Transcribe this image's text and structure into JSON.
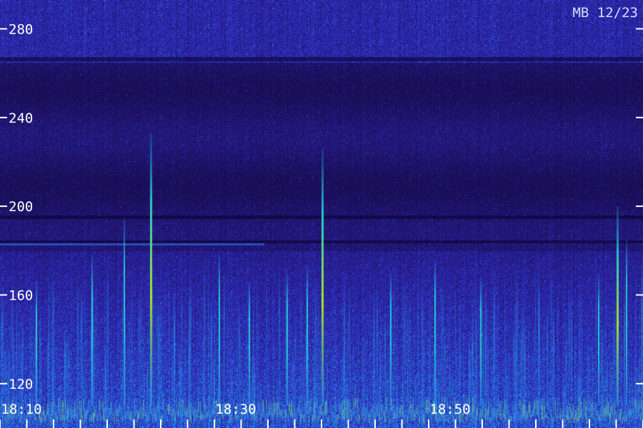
{
  "chart_data": {
    "type": "heatmap",
    "title": "MB 12/23",
    "y_ticks": [
      "280",
      "240",
      "200",
      "160",
      "120"
    ],
    "y_tick_values": [
      280,
      240,
      200,
      160,
      120
    ],
    "ylim": [
      100,
      293
    ],
    "x_ticks": [
      "18:10",
      "18:30",
      "18:50"
    ],
    "x_tick_values": [
      10,
      30,
      50
    ],
    "xlim": [
      8,
      68
    ],
    "minor_x_tick_step": 2.5,
    "colors": {
      "background": "#14063a",
      "low": "#2a1fb0",
      "mid": "#1e6ee8",
      "high": "#26c8d0",
      "peak": "#a8e628",
      "text": "#ffffff"
    },
    "bursts": [
      {
        "t": 22.0,
        "top": 233,
        "strength": 1.0
      },
      {
        "t": 38.0,
        "top": 226,
        "strength": 0.8
      },
      {
        "t": 19.5,
        "top": 195,
        "strength": 0.6
      },
      {
        "t": 16.5,
        "top": 178,
        "strength": 0.55
      },
      {
        "t": 65.5,
        "top": 200,
        "strength": 0.8
      },
      {
        "t": 66.4,
        "top": 185,
        "strength": 0.7
      },
      {
        "t": 63.8,
        "top": 170,
        "strength": 0.5
      },
      {
        "t": 36.6,
        "top": 173,
        "strength": 0.55
      },
      {
        "t": 34.7,
        "top": 170,
        "strength": 0.5
      },
      {
        "t": 48.5,
        "top": 176,
        "strength": 0.55
      },
      {
        "t": 52.8,
        "top": 168,
        "strength": 0.5
      },
      {
        "t": 44.4,
        "top": 170,
        "strength": 0.45
      },
      {
        "t": 11.3,
        "top": 166,
        "strength": 0.45
      },
      {
        "t": 28.4,
        "top": 178,
        "strength": 0.45
      },
      {
        "t": 31.2,
        "top": 166,
        "strength": 0.4
      }
    ]
  }
}
